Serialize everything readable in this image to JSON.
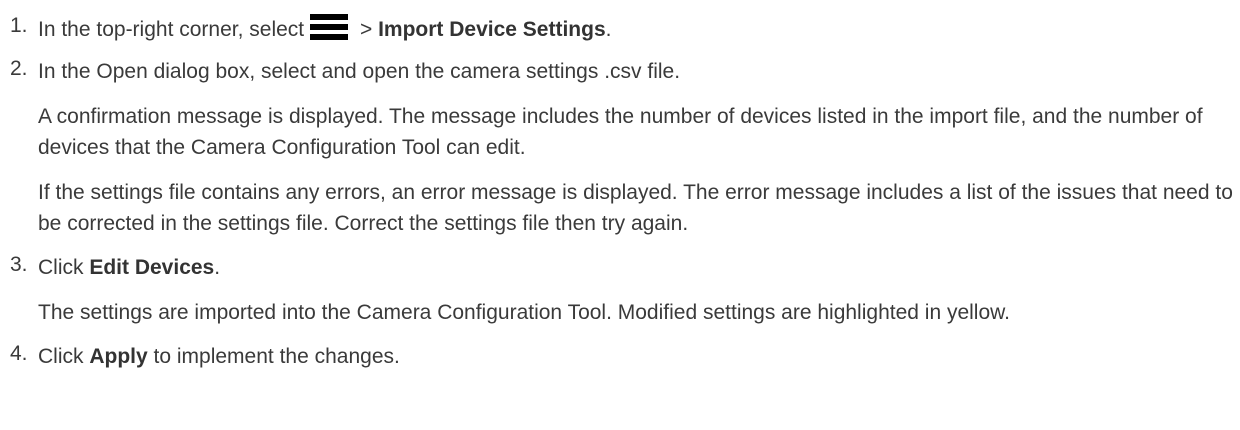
{
  "steps": [
    {
      "number": "1.",
      "prefix": "In the top-right corner, select",
      "icon": "hamburger-menu-icon",
      "arrow": " > ",
      "bold": "Import Device Settings",
      "suffix": "."
    },
    {
      "number": "2.",
      "text": "In the Open dialog box, select and open the camera settings .csv file.",
      "para1": "A confirmation message is displayed. The message includes the number of devices listed in the import file, and the number of devices that the Camera Configuration Tool can edit.",
      "para2": "If the settings file contains any errors, an error message is displayed. The error message includes a list of the issues that need to be corrected in the settings file. Correct the settings file then try again."
    },
    {
      "number": "3.",
      "prefix": "Click ",
      "bold": "Edit Devices",
      "suffix": ".",
      "para1": "The settings are imported into the Camera Configuration Tool. Modified settings are highlighted in yellow."
    },
    {
      "number": "4.",
      "prefix": "Click ",
      "bold": "Apply",
      "suffix": " to implement the changes."
    }
  ]
}
